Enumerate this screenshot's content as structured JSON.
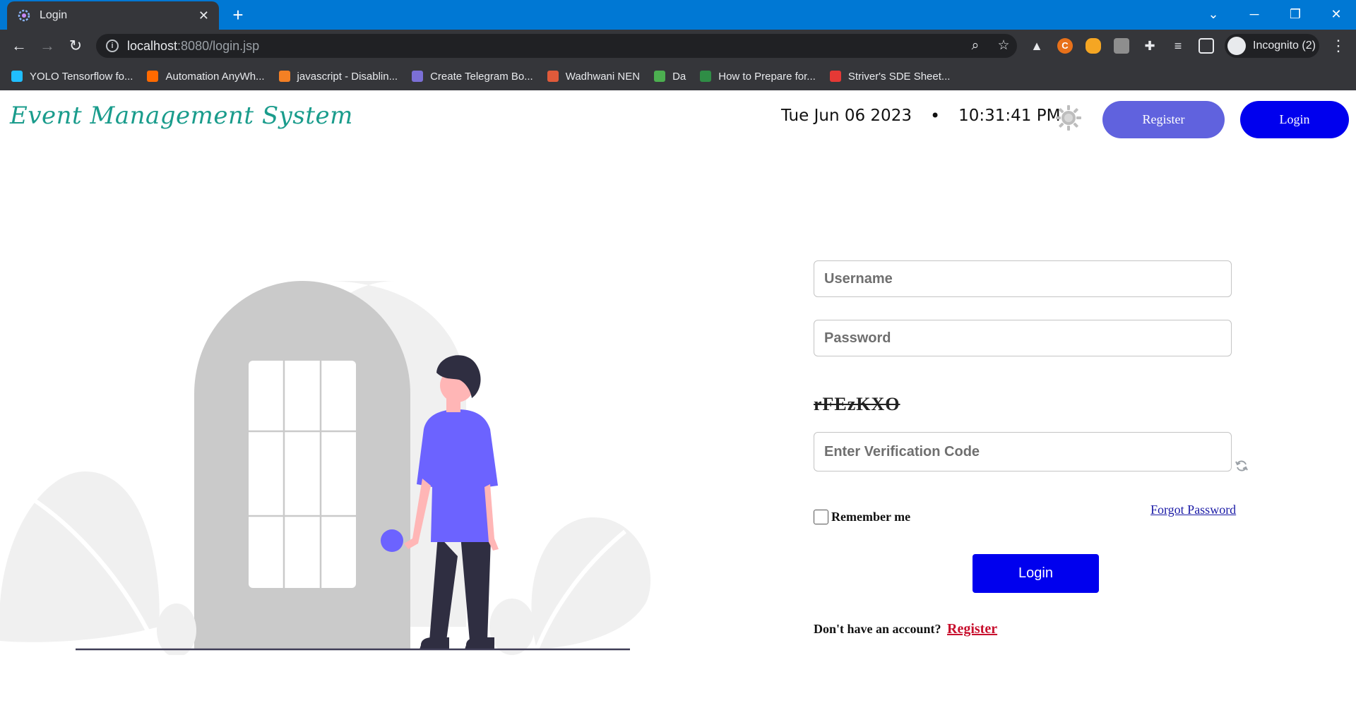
{
  "browser": {
    "tab_title": "Login",
    "url_host": "localhost",
    "url_path": ":8080/login.jsp",
    "profile_label": "Incognito (2)",
    "bookmarks": [
      {
        "label": "YOLO Tensorflow fo...",
        "icon": "k-icon",
        "color": "#20beff"
      },
      {
        "label": "Automation AnyWh...",
        "icon": "triangle-a-icon",
        "color": "#ff6a00"
      },
      {
        "label": "javascript - Disablin...",
        "icon": "stackoverflow-icon",
        "color": "#f48024"
      },
      {
        "label": "Create Telegram Bo...",
        "icon": "robot-icon",
        "color": "#7b6fd6"
      },
      {
        "label": "Wadhwani NEN",
        "icon": "building-icon",
        "color": "#e05a3a"
      },
      {
        "label": "Da",
        "icon": "umbrella-icon",
        "color": "#4caf50"
      },
      {
        "label": "How to Prepare for...",
        "icon": "gfg-icon",
        "color": "#2f8d46"
      },
      {
        "label": "Striver's SDE Sheet...",
        "icon": "tuf-icon",
        "color": "#e53935"
      }
    ]
  },
  "header": {
    "brand": "Event Management System",
    "date": "Tue Jun 06 2023",
    "separator": "•",
    "time": "10:31:41 PM",
    "register_label": "Register",
    "login_label": "Login"
  },
  "form": {
    "username_placeholder": "Username",
    "password_placeholder": "Password",
    "captcha_text": "rFEzKXO",
    "verification_placeholder": "Enter Verification Code",
    "remember_label": "Remember me",
    "forgot_label": "Forgot Password",
    "login_label": "Login",
    "signup_prompt": "Don't have an account?",
    "signup_link": "Register"
  },
  "colors": {
    "tabstrip": "#0078d4",
    "brand": "#1a9c8c",
    "register_button": "#6062de",
    "login_button": "#0000ee",
    "signup_link": "#c8102e",
    "person_shirt": "#6c63ff"
  }
}
